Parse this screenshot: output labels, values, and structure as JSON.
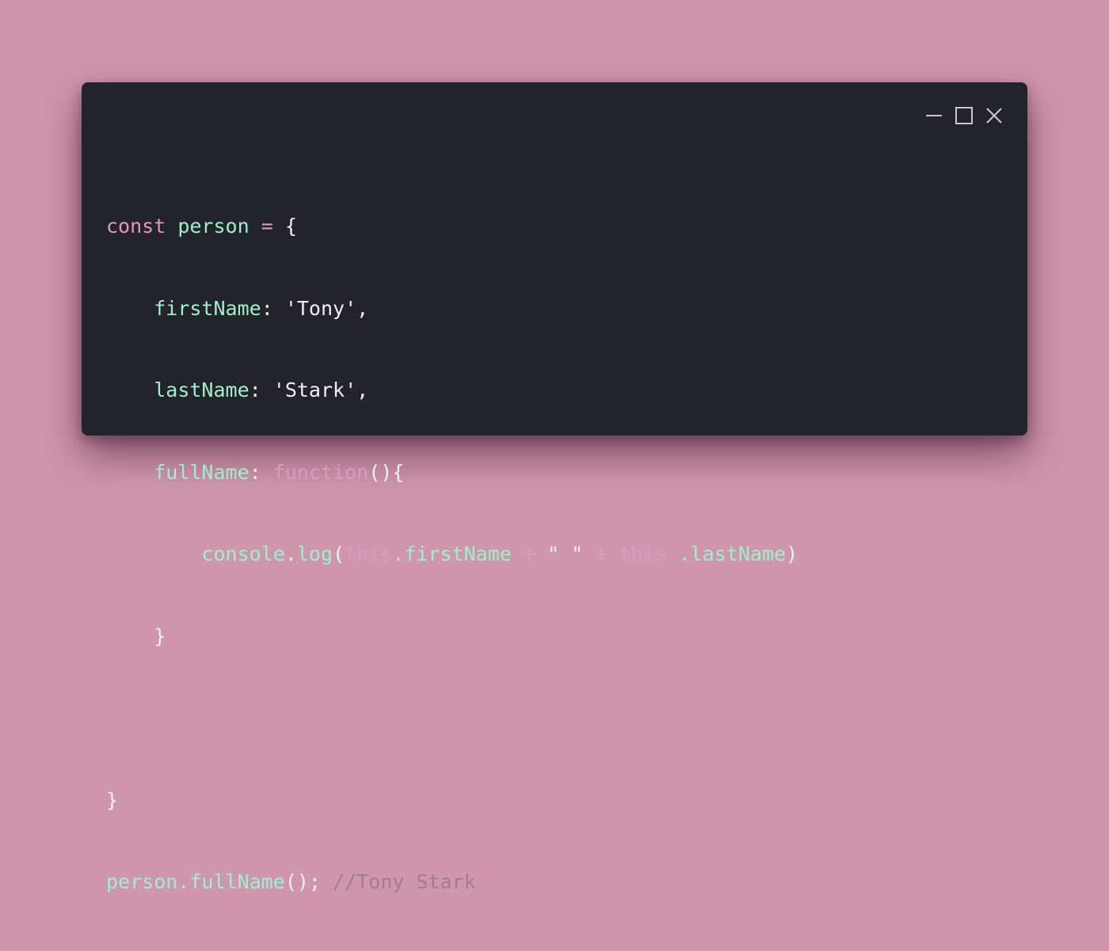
{
  "window": {
    "controls": [
      {
        "name": "minimize",
        "icon": "minimize-icon"
      },
      {
        "name": "maximize",
        "icon": "maximize-icon"
      },
      {
        "name": "close",
        "icon": "close-icon"
      }
    ]
  },
  "colors": {
    "background": "#d096ae",
    "window": "#23232c",
    "keyword": "#e098c0",
    "identifier": "#9ef0cb",
    "punctuation": "#f2eff4",
    "comment": "#9c7e95"
  },
  "code": {
    "l1": {
      "kw": "const",
      "id": "person",
      "op": "=",
      "brace": "{"
    },
    "l2": {
      "key": "firstName",
      "colon": ":",
      "str": "'Tony'",
      "comma": ","
    },
    "l3": {
      "key": "lastName",
      "colon": ":",
      "str": "'Stark'",
      "comma": ","
    },
    "l4": {
      "key": "fullName",
      "colon": ":",
      "kw": "function",
      "paren": "(){"
    },
    "l5": {
      "obj": "console",
      "dot1": ".",
      "method": "log",
      "open": "(",
      "this1": "this",
      "prop1": ".firstName",
      "plus1": "+",
      "space_str": "\" \"",
      "plus2": "+",
      "this2": "this",
      "prop2": ".lastName",
      "close": ")"
    },
    "l6": {
      "brace": "}"
    },
    "l8": {
      "brace": "}"
    },
    "l9": {
      "call": "person.fullName",
      "tail": "();",
      "comment": "//Tony Stark"
    }
  }
}
